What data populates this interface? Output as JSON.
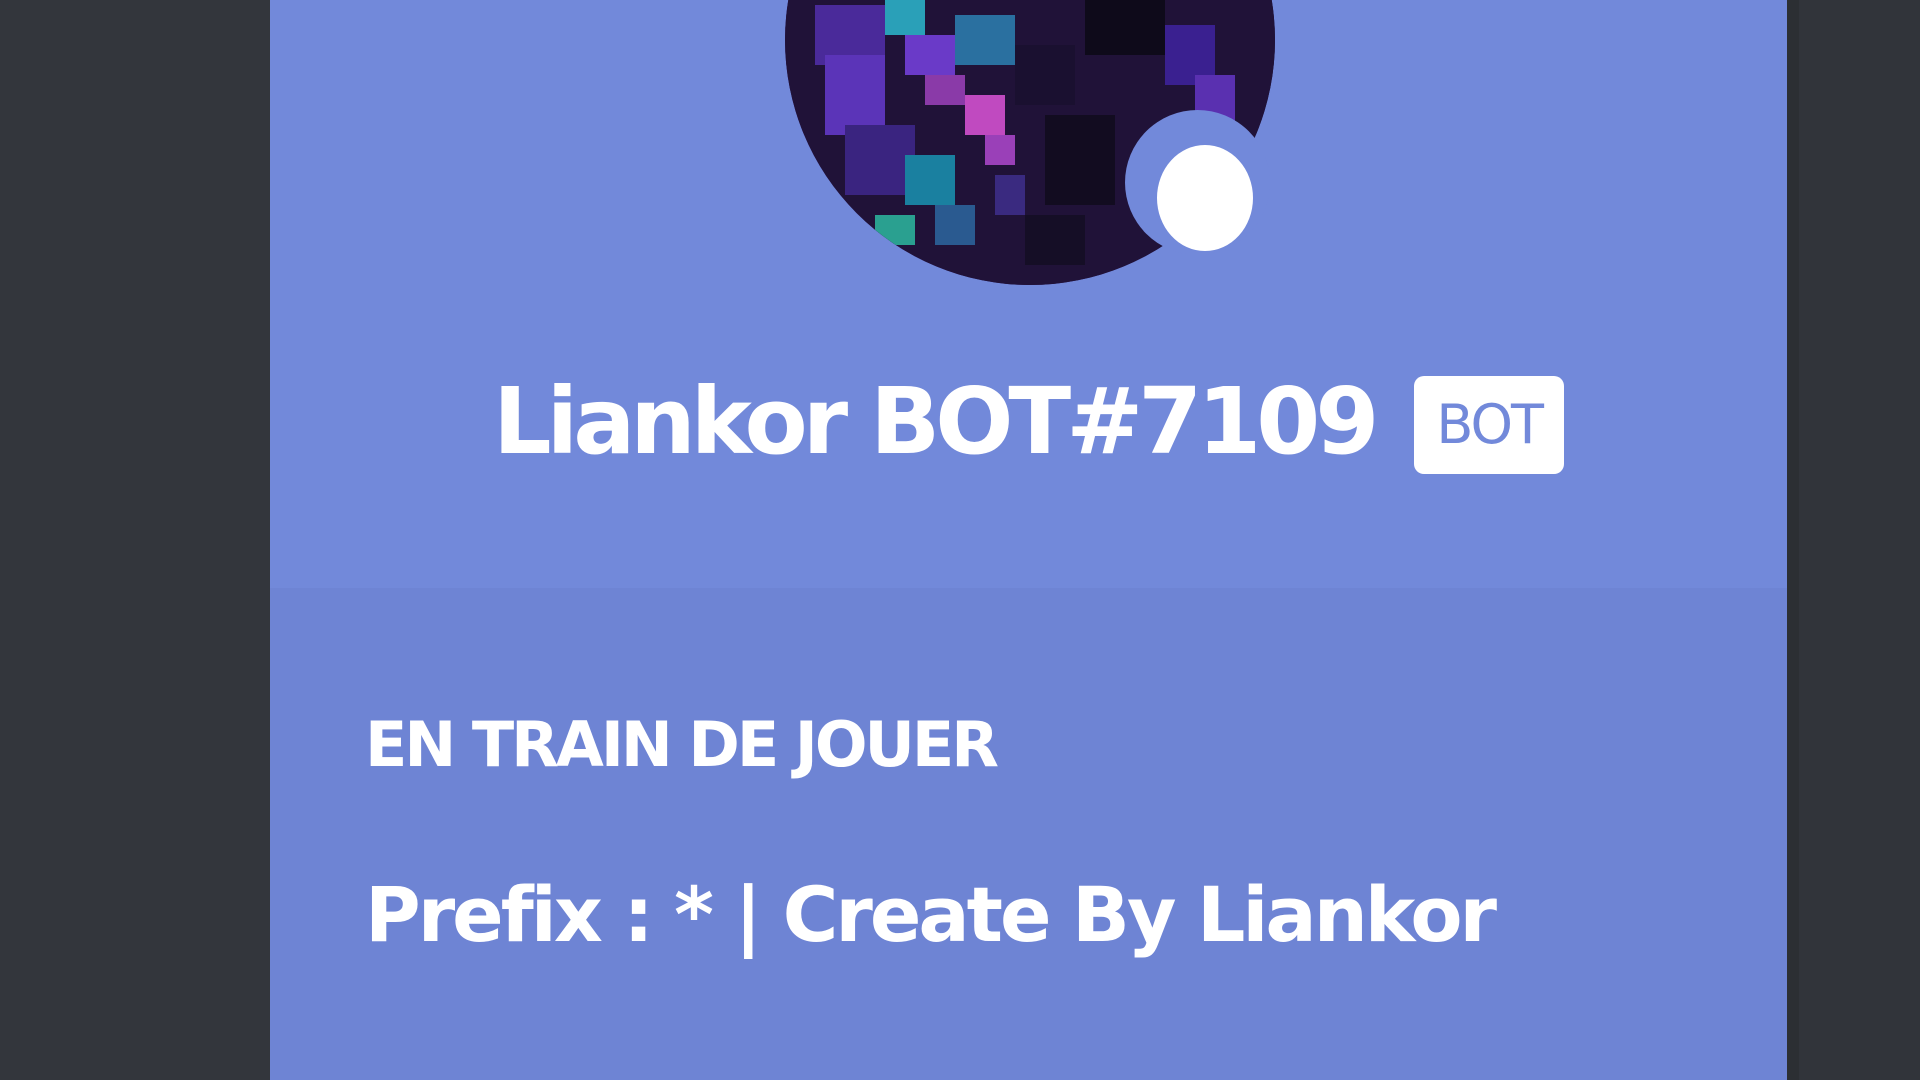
{
  "profile": {
    "username": "Liankor BOT#7109",
    "badge": "BOT",
    "avatar_icon": "pixel-art-avatar",
    "status": "online",
    "status_color": "#ffffff"
  },
  "activity": {
    "section_title": "EN TRAIN DE JOUER",
    "text": "Prefix : * | Create By Liankor"
  },
  "colors": {
    "card_header": "#7289da",
    "card_body": "#6e84d4",
    "background": "#36393f"
  }
}
